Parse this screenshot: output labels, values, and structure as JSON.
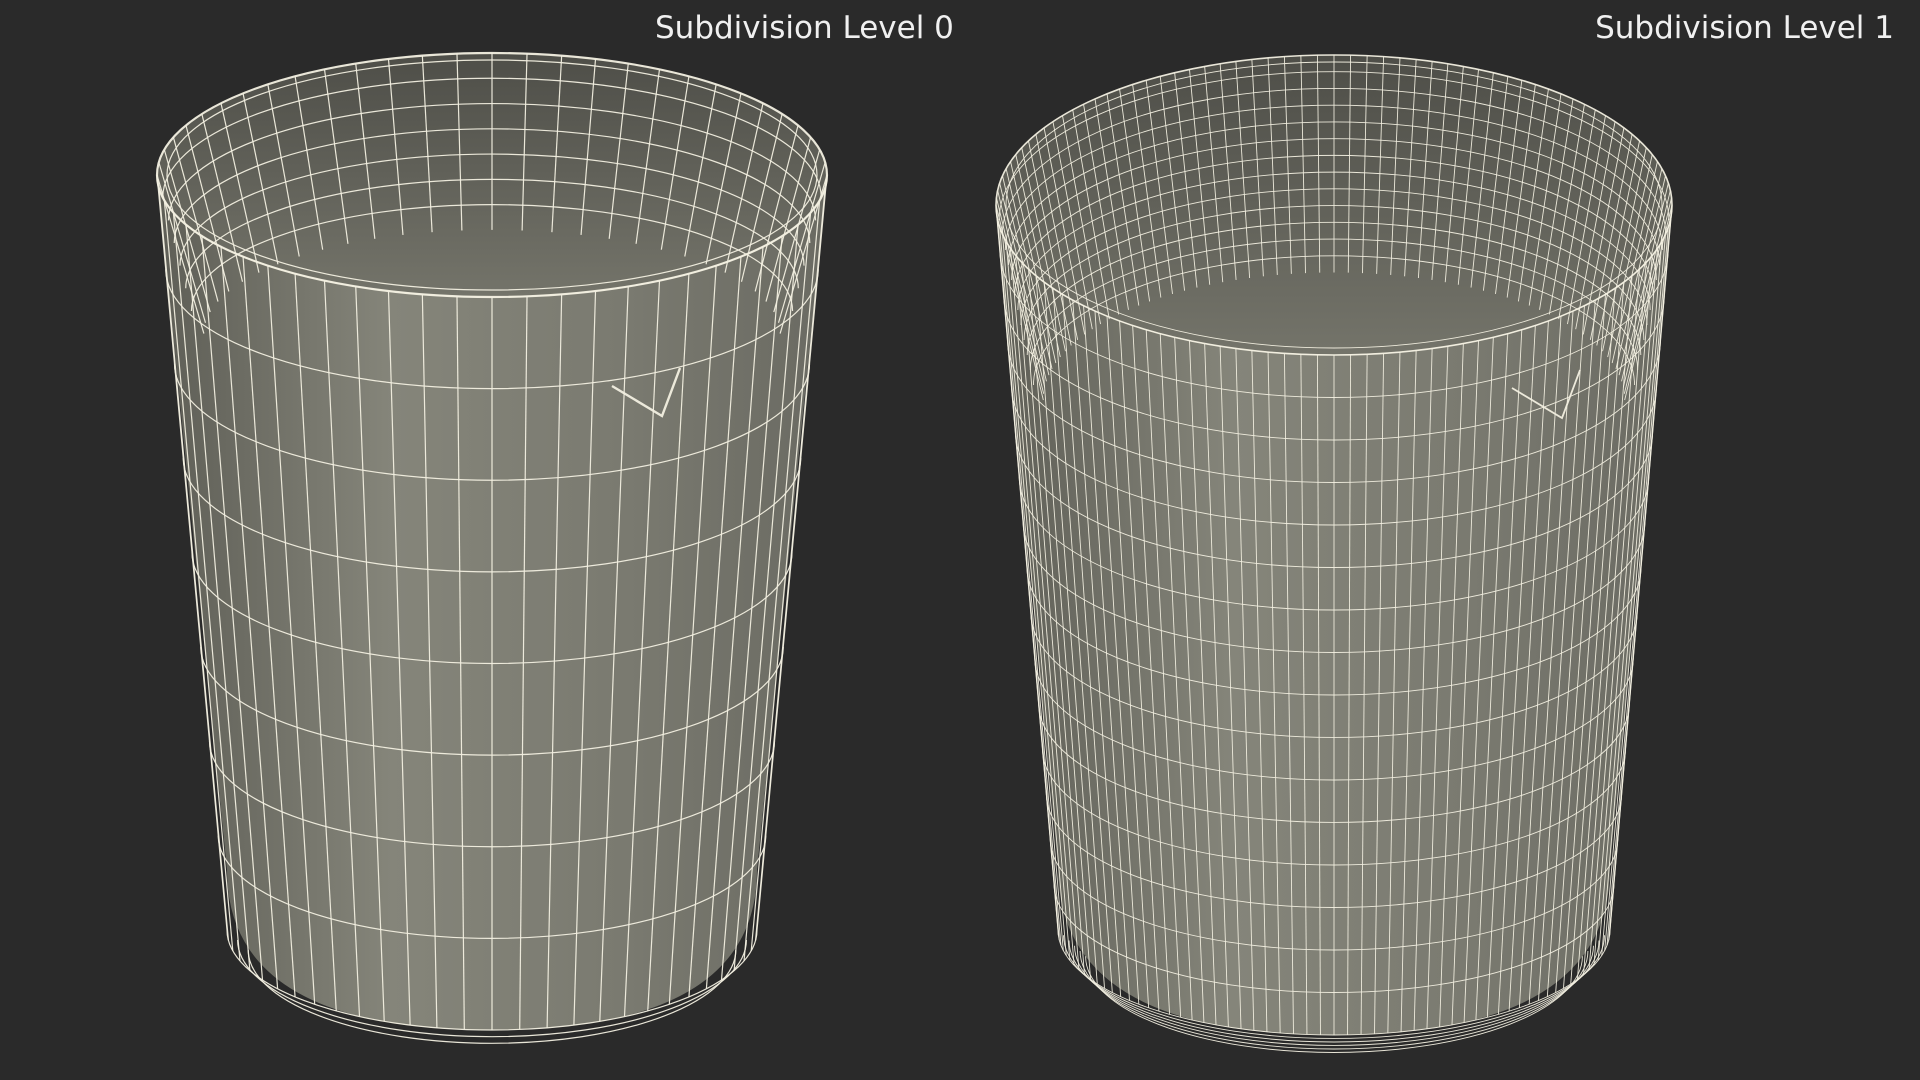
{
  "labels": {
    "left": "Subdivision Level 0",
    "right": "Subdivision Level 1"
  },
  "colors": {
    "background": "#2a2a2a",
    "mesh_fill": "#7a7a70",
    "mesh_fill_inner": "#6a6a62",
    "wire": "#f2efe0"
  },
  "models": {
    "left": {
      "name": "beaker-mesh-level-0"
    },
    "right": {
      "name": "beaker-mesh-level-1"
    }
  }
}
